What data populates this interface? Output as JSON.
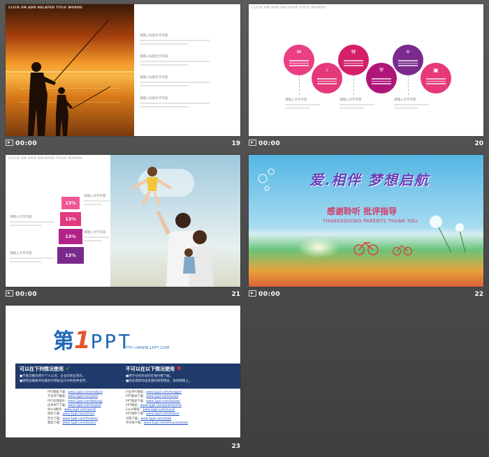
{
  "slides": [
    {
      "number": "19",
      "time": "00:00",
      "header": "CLICK ON ADD RELATED TITLE WORDS",
      "para_label": "请输入标题文字内容"
    },
    {
      "number": "20",
      "time": "00:00",
      "header": "CLICK ON ADD RELATED TITLE WORDS",
      "label": "请输入文字内容"
    },
    {
      "number": "21",
      "time": "00:00",
      "header": "CLICK ON ADD RELATED TITLE WORDS",
      "label": "请输入文字内容",
      "percent": "13%"
    },
    {
      "number": "22",
      "time": "00:00",
      "title_art": "爱.相伴 梦想启航",
      "cn_title": "感谢聆听 批评指导",
      "en_title": "THANKSGIVING PARENTS THANK YOU"
    },
    {
      "number": "23",
      "logo_cn": "第",
      "logo_num": "1",
      "logo_ppt": "PPT",
      "logo_url": "HTTP://WWW.1PPT.COM",
      "can_title": "可以在下列情况使用",
      "cannot_title": "不可以在以下情况使用",
      "can_items": [
        "不限次数的用于个人公司、企业的商业演示。",
        "使用该模板中的素材于网站设计中的各种宣传。"
      ],
      "cannot_items": [
        "用于任何形式的在线付费下载。",
        "改良或修饰该资源的商用用途，放到网络上。"
      ],
      "links_left": [
        {
          "label": "PPT模板下载：",
          "url": "www.1ppt.com/moban/"
        },
        {
          "label": "节日PPT模板：",
          "url": "www.1ppt.com/jieri/"
        },
        {
          "label": "PPT背景图片：",
          "url": "www.1ppt.com/beijing/"
        },
        {
          "label": "优秀PPT下载：",
          "url": "www.1ppt.com/xiazai/"
        },
        {
          "label": "Word教程：",
          "url": "www.1ppt.com/word/"
        },
        {
          "label": "资料下载：",
          "url": "www.1ppt.com/ziliao/"
        },
        {
          "label": "范文下载：",
          "url": "www.1ppt.com/fanwen/"
        },
        {
          "label": "教案下载：",
          "url": "www.1ppt.com/jiaoan/"
        }
      ],
      "links_right": [
        {
          "label": "行业PPT模板：",
          "url": "www.1ppt.com/hangye/"
        },
        {
          "label": "PPT素材下载：",
          "url": "www.1ppt.com/sucai/"
        },
        {
          "label": "PPT图表下载：",
          "url": "www.1ppt.com/tubiao/"
        },
        {
          "label": "PPT教程：",
          "url": "www.1ppt.com/powerpoint/"
        },
        {
          "label": "Excel教程：",
          "url": "www.1ppt.com/excel/"
        },
        {
          "label": "PPT课件下载：",
          "url": "www.1ppt.com/kejian/"
        },
        {
          "label": "试卷下载：",
          "url": "www.1ppt.com/shiti/"
        },
        {
          "label": "手抄报下载：",
          "url": "www.1ppt.com/shouchaobao/"
        }
      ]
    }
  ],
  "colors": {
    "pink": "#e6387a",
    "magenta": "#c0177a",
    "purple": "#7b2a8e",
    "navy": "#1f3a6b",
    "check": "#28a52a",
    "cross": "#d9352f"
  }
}
